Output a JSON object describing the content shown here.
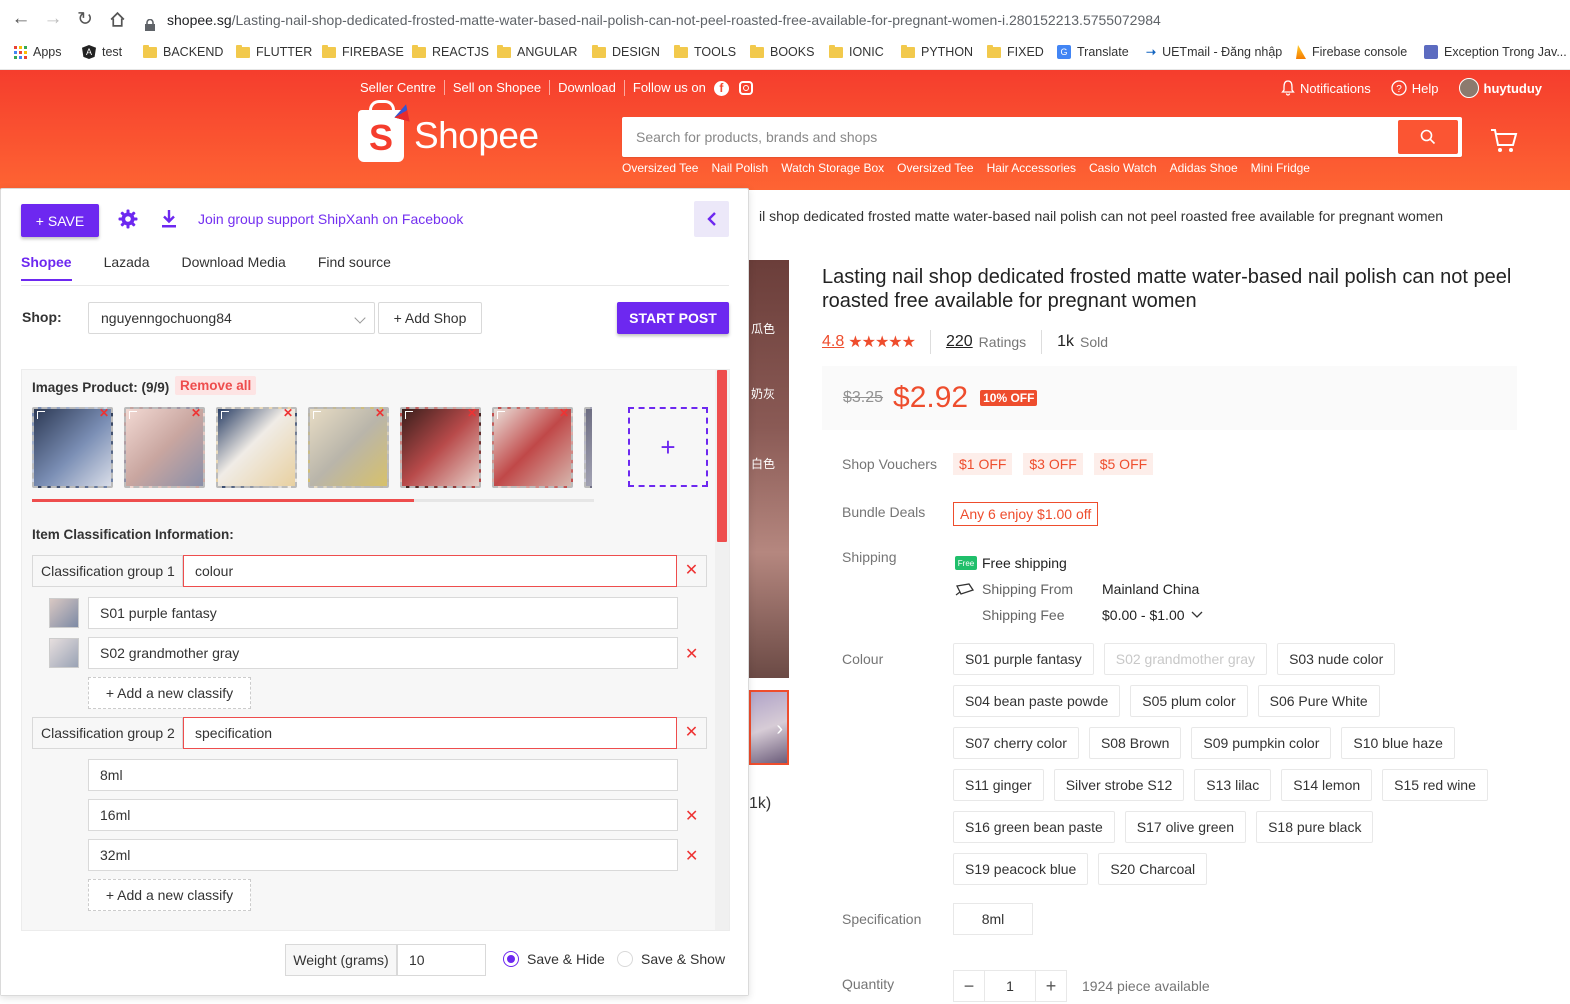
{
  "browser": {
    "url_host": "shopee.sg",
    "url_path": "/Lasting-nail-shop-dedicated-frosted-matte-water-based-nail-polish-can-not-peel-roasted-free-available-for-pregnant-women-i.280152213.5755072984",
    "bookmarks": [
      "Apps",
      "test",
      "BACKEND",
      "FLUTTER",
      "FIREBASE",
      "REACTJS",
      "ANGULAR",
      "DESIGN",
      "TOOLS",
      "BOOKS",
      "IONIC",
      "PYTHON",
      "FIXED",
      "Translate",
      "UETmail - Đăng nhập",
      "Firebase console",
      "Exception Trong Jav..."
    ]
  },
  "header": {
    "topnav": [
      "Seller Centre",
      "Sell on Shopee",
      "Download",
      "Follow us on"
    ],
    "notifications": "Notifications",
    "help": "Help",
    "username": "huytuduy",
    "logo": "Shopee",
    "search_placeholder": "Search for products, brands and shops",
    "suggestions": [
      "Oversized Tee",
      "Nail Polish",
      "Watch Storage Box",
      "Oversized Tee",
      "Hair Accessories",
      "Casio Watch",
      "Adidas Shoe",
      "Mini Fridge"
    ],
    "brand_color": "#ee4d2d"
  },
  "product": {
    "breadcrumb": "il shop dedicated frosted matte water-based nail polish can not peel roasted free available for pregnant women",
    "gallery_labels": [
      "瓜色",
      "奶灰",
      "白色"
    ],
    "rating_fragment": "1k)",
    "title": "Lasting nail shop dedicated frosted matte water-based nail polish can not peel roasted free available for pregnant women",
    "rating": "4.8",
    "stars": "★★★★★",
    "ratings_count": "220",
    "ratings_label": "Ratings",
    "sold_count": "1k",
    "sold_label": "Sold",
    "old_price": "$3.25",
    "price": "$2.92",
    "discount": "10% OFF",
    "shop_vouchers_label": "Shop Vouchers",
    "vouchers": [
      "$1 OFF",
      "$3 OFF",
      "$5 OFF"
    ],
    "bundle_label": "Bundle Deals",
    "bundle": "Any 6 enjoy $1.00 off",
    "shipping_label": "Shipping",
    "free_badge": "Free",
    "free_shipping": "Free shipping",
    "shipping_from_label": "Shipping From",
    "shipping_from": "Mainland China",
    "shipping_fee_label": "Shipping Fee",
    "shipping_fee": "$0.00 - $1.00",
    "colour_label": "Colour",
    "colours": [
      "S01 purple fantasy",
      "S02 grandmother gray",
      "S03 nude color",
      "S04 bean paste powde",
      "S05 plum color",
      "S06 Pure White",
      "S07 cherry color",
      "S08 Brown",
      "S09 pumpkin color",
      "S10 blue haze",
      "S11 ginger",
      "Silver strobe S12",
      "S13 lilac",
      "S14 lemon",
      "S15 red wine",
      "S16 green bean paste",
      "S17 olive green",
      "S18 pure black",
      "S19 peacock blue",
      "S20 Charcoal"
    ],
    "disabled_colour": "S02 grandmother gray",
    "specification_label": "Specification",
    "specification": "8ml",
    "quantity_label": "Quantity",
    "quantity": "1",
    "available": "1924 piece available"
  },
  "panel": {
    "save": "+ SAVE",
    "join": "Join group support ShipXanh on Facebook",
    "tabs": [
      "Shopee",
      "Lazada",
      "Download Media",
      "Find source"
    ],
    "shop_label": "Shop:",
    "shop_value": "nguyenngochuong84",
    "add_shop": "+ Add Shop",
    "start_post": "START POST",
    "images_label": "Images Product: (9/9)",
    "remove_all": "Remove all",
    "scroll_progress": 0.68,
    "classification_label": "Item Classification Information:",
    "group1_label": "Classification group 1",
    "group1_value": "colour",
    "group1_items": [
      "S01 purple fantasy",
      "S02 grandmother gray"
    ],
    "add_classify": "+ Add a new classify",
    "group2_label": "Classification group 2",
    "group2_value": "specification",
    "group2_items": [
      "8ml",
      "16ml",
      "32ml"
    ],
    "weight_label": "Weight (grams)",
    "weight_value": "10",
    "save_hide": "Save & Hide",
    "save_show": "Save & Show",
    "accent": "#6d28f0"
  }
}
